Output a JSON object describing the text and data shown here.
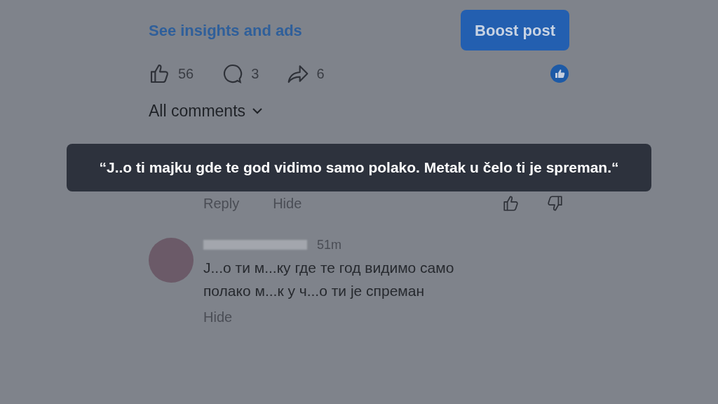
{
  "post_actions": {
    "insights_link": "See insights and ads",
    "boost_button": "Boost post"
  },
  "stats": [
    {
      "kind": "like",
      "count": "56"
    },
    {
      "kind": "comment",
      "count": "3"
    },
    {
      "kind": "share",
      "count": "6"
    }
  ],
  "comments_filter": "All comments",
  "comments": [
    {
      "kind": "covered",
      "actions": [
        "Reply",
        "Hide"
      ]
    },
    {
      "kind": "full",
      "time": "51m",
      "text": "J...o ти м...ку где те год видимо само полако м...к у ч...о ти је спреман",
      "actions": [
        "Hide"
      ]
    }
  ],
  "caption": "“J..o ti majku gde te god vidimo samo polako. Metak u čelo ti je spreman.“"
}
